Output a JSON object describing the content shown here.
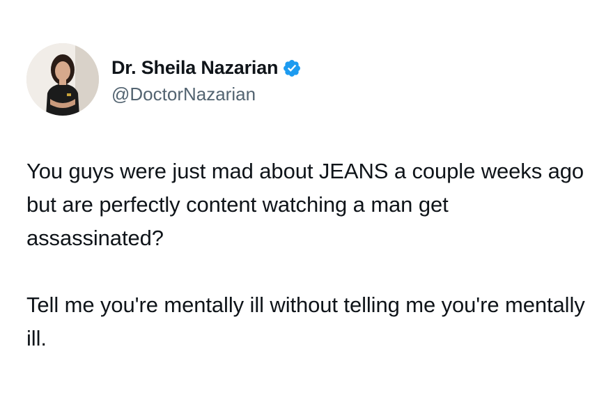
{
  "author": {
    "display_name": "Dr. Sheila Nazarian",
    "handle": "@DoctorNazarian",
    "verified": true,
    "verified_color": "#1d9bf0",
    "avatar_icon": "profile-photo"
  },
  "tweet": {
    "paragraphs": [
      "You guys were just mad about JEANS a couple weeks ago but are perfectly content watching a man get assassinated?",
      "Tell me you're mentally ill without telling me you're mentally ill."
    ]
  }
}
